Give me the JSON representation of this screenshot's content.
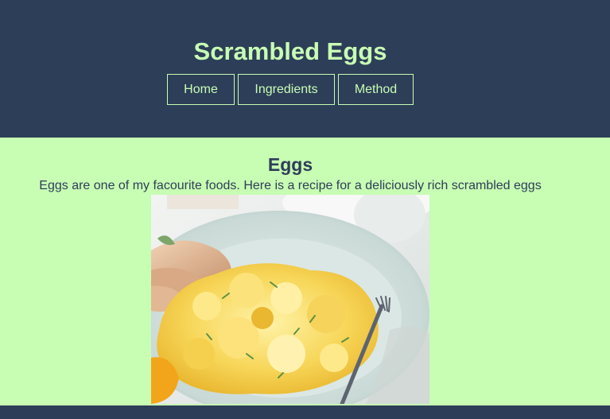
{
  "header": {
    "title": "Scrambled Eggs",
    "nav": [
      {
        "label": "Home"
      },
      {
        "label": "Ingredients"
      },
      {
        "label": "Method"
      }
    ]
  },
  "main": {
    "heading": "Eggs",
    "intro": "Eggs are one of my facourite foods. Here is a recipe for a deliciously rich scrambled eggs",
    "image_subject": "scrambled-eggs-plate"
  },
  "colors": {
    "header_bg": "#2d3e58",
    "body_bg": "#c8fdb4",
    "accent_text": "#c8fdb4",
    "dark_text": "#2d3e58"
  }
}
